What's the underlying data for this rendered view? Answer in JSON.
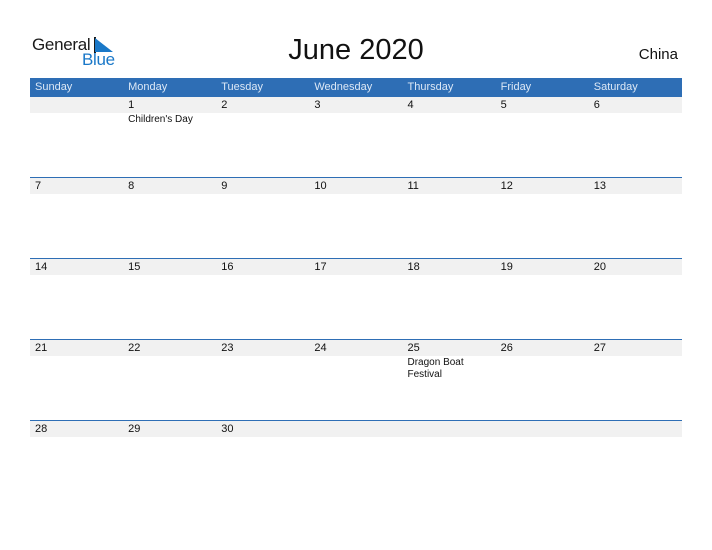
{
  "logo": {
    "word1": "General",
    "word2": "Blue"
  },
  "title": "June 2020",
  "country": "China",
  "weekdays": [
    "Sunday",
    "Monday",
    "Tuesday",
    "Wednesday",
    "Thursday",
    "Friday",
    "Saturday"
  ],
  "weeks": [
    [
      {
        "day": "",
        "event": ""
      },
      {
        "day": "1",
        "event": "Children's Day"
      },
      {
        "day": "2",
        "event": ""
      },
      {
        "day": "3",
        "event": ""
      },
      {
        "day": "4",
        "event": ""
      },
      {
        "day": "5",
        "event": ""
      },
      {
        "day": "6",
        "event": ""
      }
    ],
    [
      {
        "day": "7",
        "event": ""
      },
      {
        "day": "8",
        "event": ""
      },
      {
        "day": "9",
        "event": ""
      },
      {
        "day": "10",
        "event": ""
      },
      {
        "day": "11",
        "event": ""
      },
      {
        "day": "12",
        "event": ""
      },
      {
        "day": "13",
        "event": ""
      }
    ],
    [
      {
        "day": "14",
        "event": ""
      },
      {
        "day": "15",
        "event": ""
      },
      {
        "day": "16",
        "event": ""
      },
      {
        "day": "17",
        "event": ""
      },
      {
        "day": "18",
        "event": ""
      },
      {
        "day": "19",
        "event": ""
      },
      {
        "day": "20",
        "event": ""
      }
    ],
    [
      {
        "day": "21",
        "event": ""
      },
      {
        "day": "22",
        "event": ""
      },
      {
        "day": "23",
        "event": ""
      },
      {
        "day": "24",
        "event": ""
      },
      {
        "day": "25",
        "event": "Dragon Boat Festival"
      },
      {
        "day": "26",
        "event": ""
      },
      {
        "day": "27",
        "event": ""
      }
    ],
    [
      {
        "day": "28",
        "event": ""
      },
      {
        "day": "29",
        "event": ""
      },
      {
        "day": "30",
        "event": ""
      },
      {
        "day": "",
        "event": ""
      },
      {
        "day": "",
        "event": ""
      },
      {
        "day": "",
        "event": ""
      },
      {
        "day": "",
        "event": ""
      }
    ]
  ],
  "colors": {
    "header_bg": "#2e6eb5",
    "brand_blue": "#1a78c8",
    "date_strip": "#f1f1f1"
  }
}
